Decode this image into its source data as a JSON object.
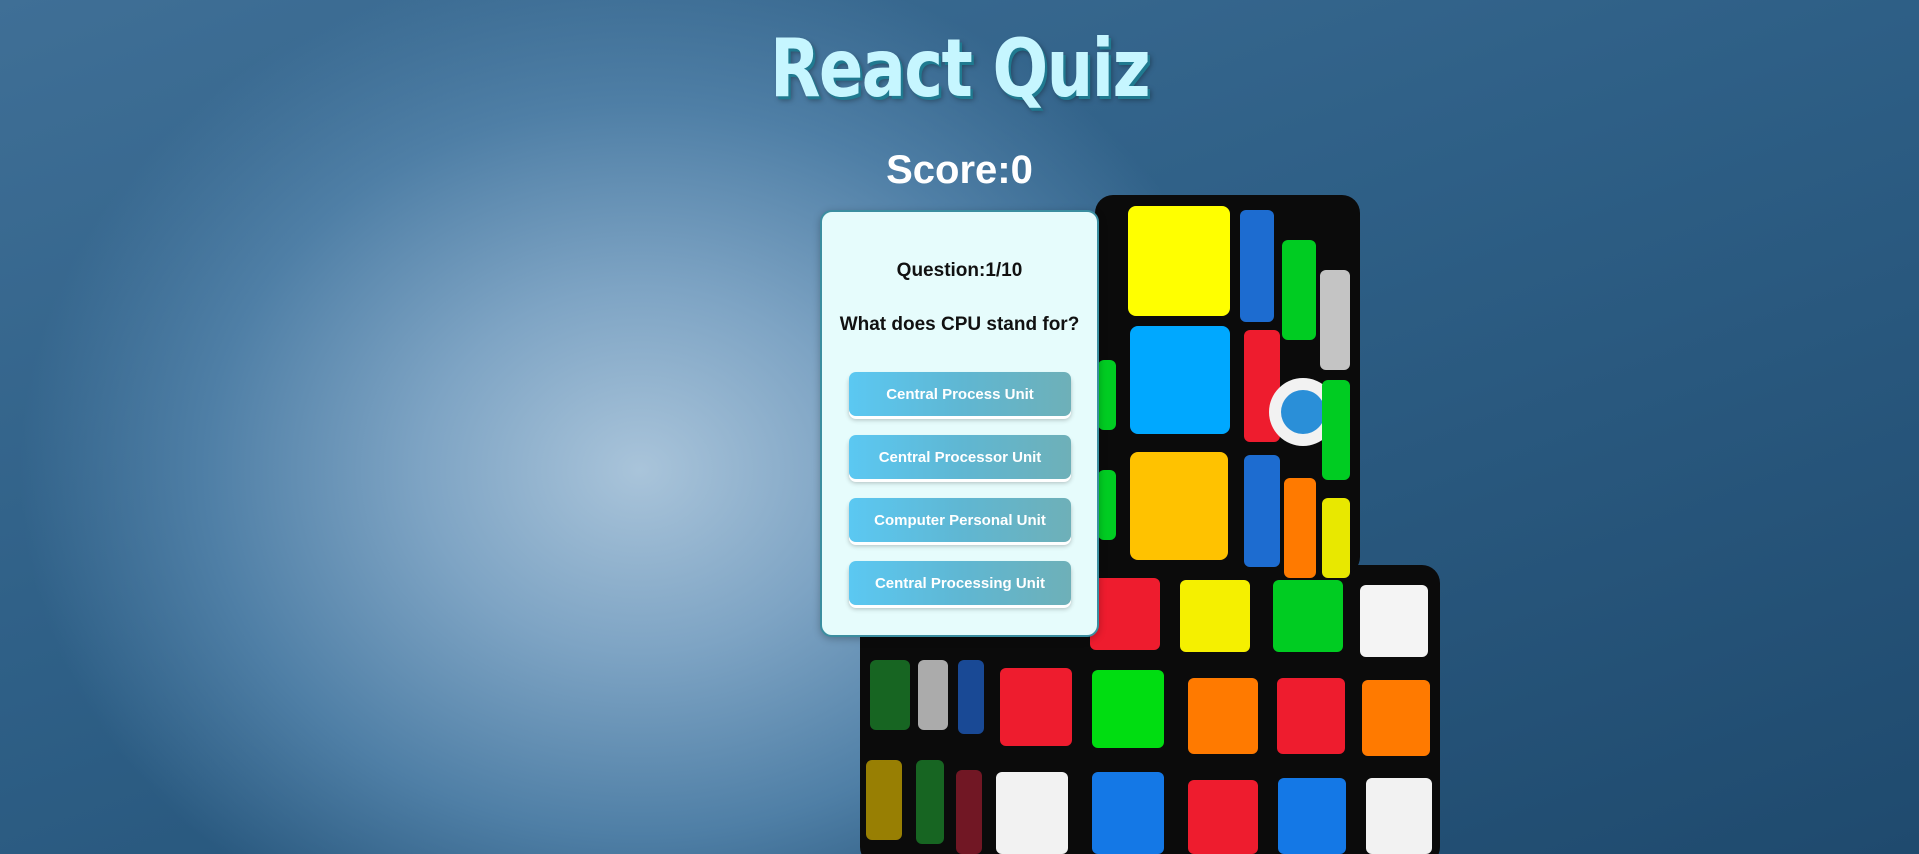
{
  "header": {
    "title": "React Quiz",
    "score_label": "Score:0"
  },
  "quiz": {
    "question_number": "Question:1/10",
    "question_text": "What does CPU stand for?",
    "answers": [
      "Central Process Unit",
      "Central Processor Unit",
      "Computer Personal Unit",
      "Central Processing Unit"
    ]
  },
  "background": {
    "image": "rubiks-cube-photo",
    "colors": {
      "sky_top": "#1f4a6e",
      "glow": "#a9c4da"
    }
  },
  "colors": {
    "title_fill": "#c6f6ff",
    "title_shadow": "#1f7a90",
    "card_bg": "#e6fcfc",
    "card_border": "#3b8ea0",
    "button_start": "#5bc8f2",
    "button_end": "#6eb0b8"
  }
}
